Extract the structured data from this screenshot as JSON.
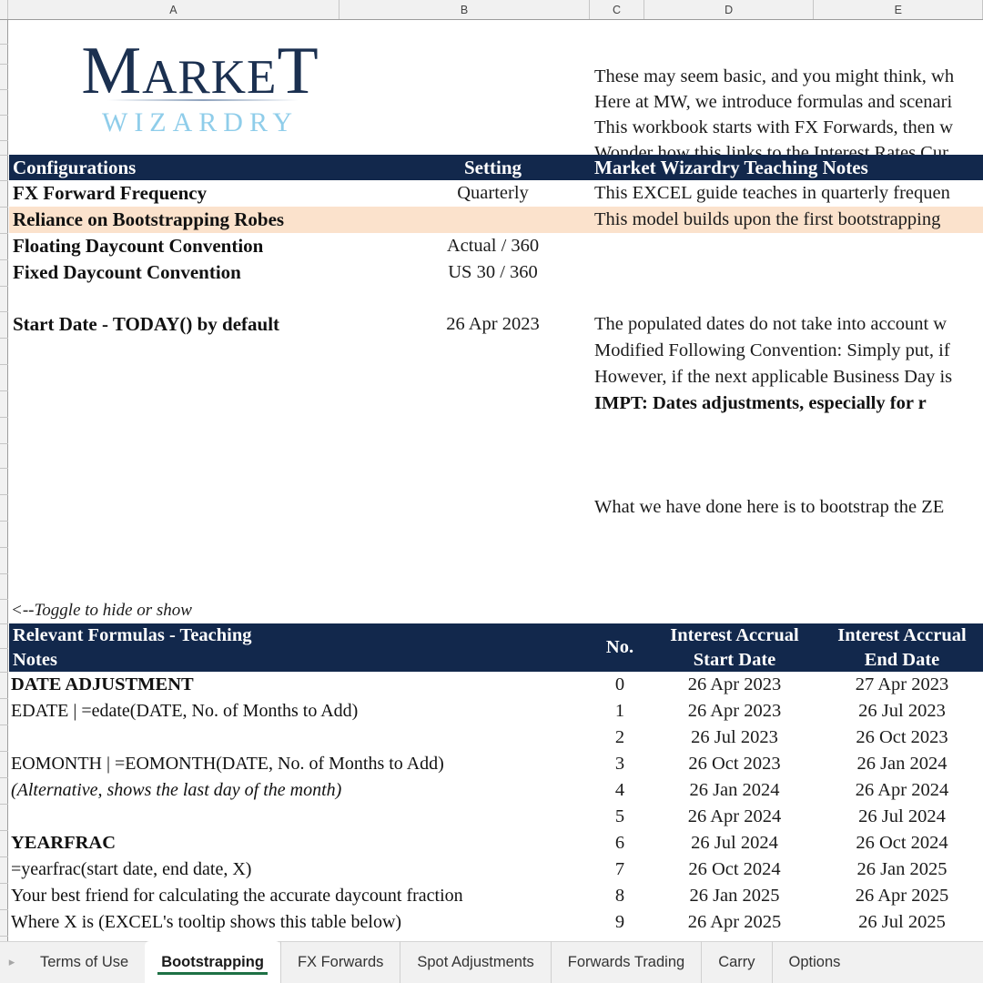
{
  "columns": [
    "A",
    "B",
    "C",
    "D",
    "E"
  ],
  "logo": {
    "word_market": "MARKET",
    "market_m": "M",
    "market_arke": "ARKE",
    "market_t": "T",
    "word_wizardry": "WIZARDRY"
  },
  "intro_notes": [
    "These may seem basic, and you might think, wh",
    "Here at MW, we introduce formulas and scenari",
    "This workbook starts with FX Forwards, then w",
    "Wonder how this links to the Interest Rates Cur"
  ],
  "config_table": {
    "header_left": "Configurations",
    "header_setting": "Setting",
    "header_notes": "Market Wizardry Teaching Notes",
    "rows": [
      {
        "label": "FX Forward Frequency",
        "setting": "Quarterly",
        "note": "This EXCEL guide teaches in quarterly frequen",
        "highlight": false
      },
      {
        "label": "Reliance on Bootstrapping Robes",
        "setting": "",
        "note": "This model builds upon the first bootstrapping",
        "highlight": true
      },
      {
        "label": "Floating Daycount Convention",
        "setting": "Actual / 360",
        "note": "",
        "highlight": false
      },
      {
        "label": "Fixed Daycount Convention",
        "setting": "US 30 / 360",
        "note": "",
        "highlight": false
      }
    ],
    "start_date_label": "Start Date - TODAY() by default",
    "start_date_value": "26 Apr 2023"
  },
  "date_notes": [
    "The populated dates do not take into account w",
    "Modified Following Convention: Simply put, if",
    "However, if the next applicable Business Day is",
    "IMPT: Dates adjustments, especially for r"
  ],
  "bootstrap_note": "What we have done here is to bootstrap the ZE",
  "toggle_note": "<--Toggle to hide or show",
  "formula_table": {
    "header_title_line1": "Relevant Formulas - Teaching",
    "header_title_line2": "Notes",
    "header_no": "No.",
    "header_start_line1": "Interest Accrual",
    "header_start_line2": "Start Date",
    "header_end_line1": "Interest Accrual",
    "header_end_line2": "End Date",
    "rows": [
      {
        "text": "DATE ADJUSTMENT",
        "style": "bold",
        "no": "0",
        "start": "26 Apr 2023",
        "end": "27 Apr 2023"
      },
      {
        "text": "EDATE | =edate(DATE, No. of Months to Add)",
        "style": "normal",
        "no": "1",
        "start": "26 Apr 2023",
        "end": "26 Jul 2023"
      },
      {
        "text": "",
        "style": "normal",
        "no": "2",
        "start": "26 Jul 2023",
        "end": "26 Oct 2023"
      },
      {
        "text": "EOMONTH | =EOMONTH(DATE, No. of Months to Add)",
        "style": "normal",
        "no": "3",
        "start": "26 Oct 2023",
        "end": "26 Jan 2024"
      },
      {
        "text": "(Alternative, shows the last day of the month)",
        "style": "italic",
        "no": "4",
        "start": "26 Jan 2024",
        "end": "26 Apr 2024"
      },
      {
        "text": "",
        "style": "normal",
        "no": "5",
        "start": "26 Apr 2024",
        "end": "26 Jul 2024"
      },
      {
        "text": "YEARFRAC",
        "style": "bold",
        "no": "6",
        "start": "26 Jul 2024",
        "end": "26 Oct 2024"
      },
      {
        "text": "=yearfrac(start date, end date, X)",
        "style": "normal",
        "no": "7",
        "start": "26 Oct 2024",
        "end": "26 Jan 2025"
      },
      {
        "text": "Your best friend for calculating the accurate daycount fraction",
        "style": "normal",
        "no": "8",
        "start": "26 Jan 2025",
        "end": "26 Apr 2025"
      },
      {
        "text": "Where X is (EXCEL's tooltip shows this table below)",
        "style": "normal",
        "no": "9",
        "start": "26 Apr 2025",
        "end": "26 Jul 2025"
      }
    ]
  },
  "tabs": [
    {
      "label": "Terms of Use",
      "active": false
    },
    {
      "label": "Bootstrapping",
      "active": true
    },
    {
      "label": "FX Forwards",
      "active": false
    },
    {
      "label": "Spot Adjustments",
      "active": false
    },
    {
      "label": "Forwards Trading",
      "active": false
    },
    {
      "label": "Carry",
      "active": false
    },
    {
      "label": "Options",
      "active": false
    }
  ],
  "colors": {
    "header_navy": "#12284c",
    "highlight_peach": "#fbe2cc",
    "logo_navy": "#1b3050",
    "logo_blue": "#8fcdea",
    "active_tab_underline": "#1e7145"
  },
  "icons": {
    "tab_nav_right": "▸"
  }
}
